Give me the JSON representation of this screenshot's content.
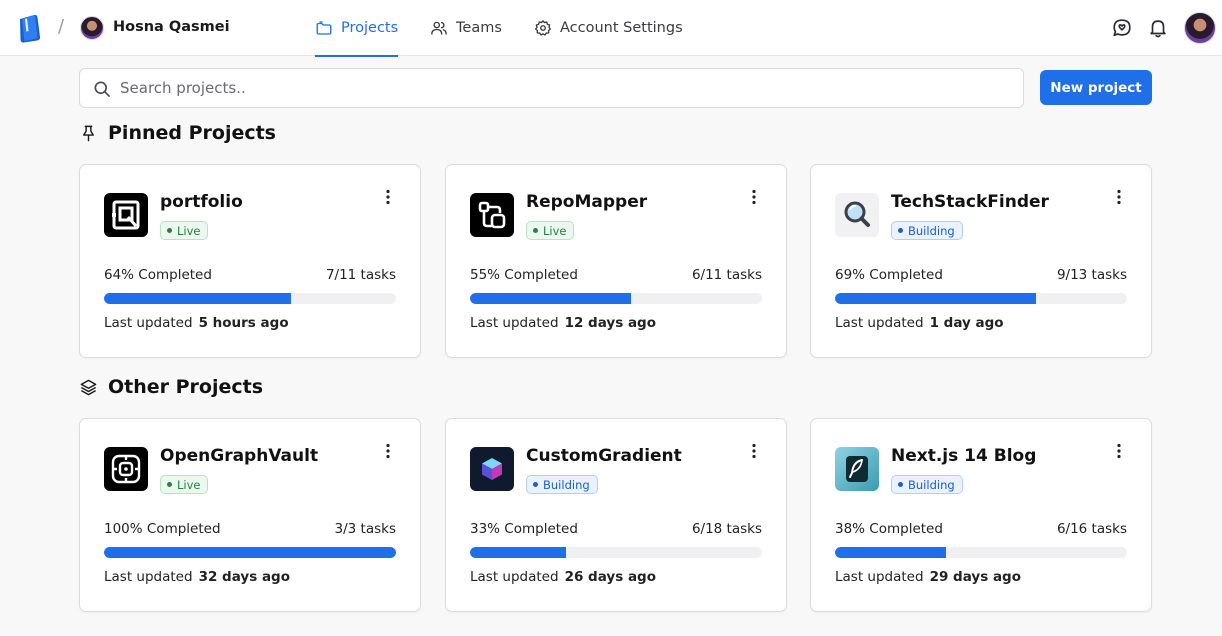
{
  "header": {
    "breadcrumb_separator": "/",
    "user_name": "Hosna Qasmei",
    "tabs": [
      {
        "label": "Projects",
        "icon": "folder-icon",
        "active": true
      },
      {
        "label": "Teams",
        "icon": "users-icon",
        "active": false
      },
      {
        "label": "Account Settings",
        "icon": "gear-icon",
        "active": false
      }
    ],
    "accent_color": "#1e6fe8"
  },
  "search": {
    "placeholder": "Search projects..",
    "value": ""
  },
  "new_project_label": "New project",
  "sections": {
    "pinned_title": "Pinned Projects",
    "other_title": "Other Projects"
  },
  "labels": {
    "last_updated": "Last updated"
  },
  "pinned_projects": [
    {
      "name": "portfolio",
      "status": "Live",
      "progress_percent": 64,
      "completed_text": "64% Completed",
      "tasks_text": "7/11 tasks",
      "updated_text": "5 hours ago",
      "logo": "portfolio-logo"
    },
    {
      "name": "RepoMapper",
      "status": "Live",
      "progress_percent": 55,
      "completed_text": "55% Completed",
      "tasks_text": "6/11 tasks",
      "updated_text": "12 days ago",
      "logo": "repomapper-logo"
    },
    {
      "name": "TechStackFinder",
      "status": "Building",
      "progress_percent": 69,
      "completed_text": "69% Completed",
      "tasks_text": "9/13 tasks",
      "updated_text": "1 day ago",
      "logo": "magnifier-logo"
    }
  ],
  "other_projects": [
    {
      "name": "OpenGraphVault",
      "status": "Live",
      "progress_percent": 100,
      "completed_text": "100% Completed",
      "tasks_text": "3/3 tasks",
      "updated_text": "32 days ago",
      "logo": "opengraphvault-logo"
    },
    {
      "name": "CustomGradient",
      "status": "Building",
      "progress_percent": 33,
      "completed_text": "33% Completed",
      "tasks_text": "6/18 tasks",
      "updated_text": "26 days ago",
      "logo": "cube-logo"
    },
    {
      "name": "Next.js 14 Blog",
      "status": "Building",
      "progress_percent": 38,
      "completed_text": "38% Completed",
      "tasks_text": "6/16 tasks",
      "updated_text": "29 days ago",
      "logo": "feather-logo"
    }
  ]
}
